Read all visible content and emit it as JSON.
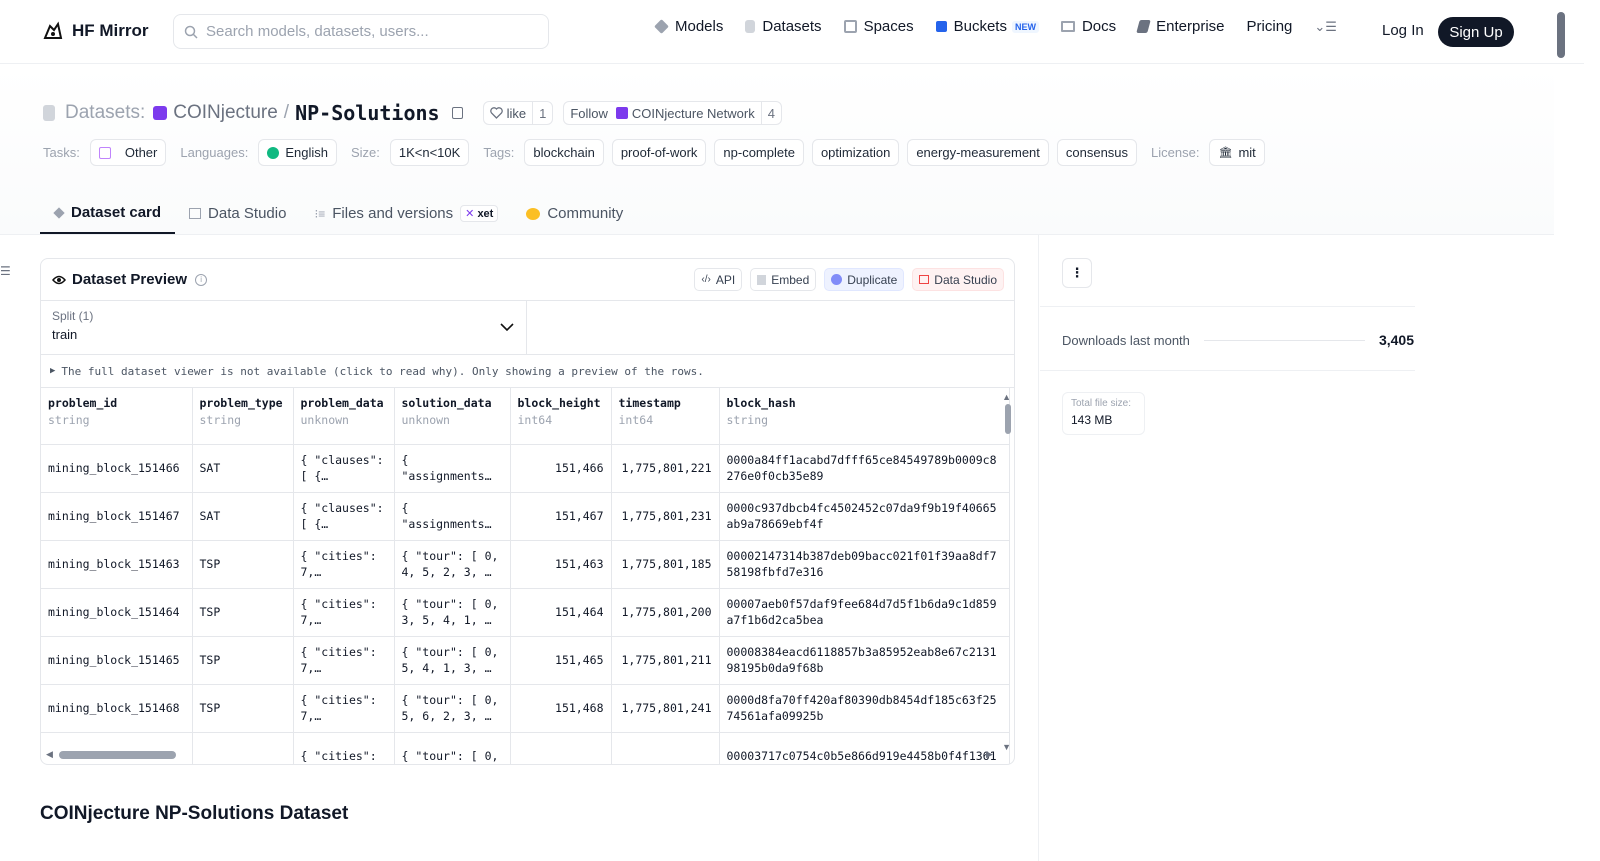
{
  "nav": {
    "brand": "HF Mirror",
    "search_placeholder": "Search models, datasets, users...",
    "links": {
      "models": "Models",
      "datasets": "Datasets",
      "spaces": "Spaces",
      "buckets": "Buckets",
      "buckets_badge": "NEW",
      "docs": "Docs",
      "enterprise": "Enterprise",
      "pricing": "Pricing"
    },
    "login": "Log In",
    "signup": "Sign Up"
  },
  "header": {
    "section_label": "Datasets:",
    "org": "COINjecture",
    "separator": "/",
    "name": "NP-Solutions",
    "like_label": "like",
    "like_count": "1",
    "follow_label": "Follow",
    "follow_org": "COINjecture Network",
    "follow_count": "4"
  },
  "tags": {
    "tasks_label": "Tasks:",
    "task": "Other",
    "languages_label": "Languages:",
    "language": "English",
    "size_label": "Size:",
    "size": "1K<n<10K",
    "tags_label": "Tags:",
    "tag_list": [
      "blockchain",
      "proof-of-work",
      "np-complete",
      "optimization",
      "energy-measurement",
      "consensus"
    ],
    "license_label": "License:",
    "license": "mit"
  },
  "tabs": {
    "dataset_card": "Dataset card",
    "data_studio": "Data Studio",
    "files": "Files and versions",
    "xet": "xet",
    "community": "Community"
  },
  "preview": {
    "title": "Dataset Preview",
    "buttons": {
      "api": "API",
      "embed": "Embed",
      "duplicate": "Duplicate",
      "data_studio": "Data Studio"
    },
    "split_label": "Split (1)",
    "split_value": "train",
    "notice": "The full dataset viewer is not available (click to read why). Only showing a preview of the rows.",
    "columns": [
      {
        "name": "problem_id",
        "type": "string"
      },
      {
        "name": "problem_type",
        "type": "string"
      },
      {
        "name": "problem_data",
        "type": "unknown"
      },
      {
        "name": "solution_data",
        "type": "unknown"
      },
      {
        "name": "block_height",
        "type": "int64"
      },
      {
        "name": "timestamp",
        "type": "int64"
      },
      {
        "name": "block_hash",
        "type": "string"
      }
    ],
    "rows": [
      [
        "mining_block_151466",
        "SAT",
        "{ \"clauses\":\n[ {…",
        "{\n\"assignments…",
        "151,466",
        "1,775,801,221",
        "0000a84ff1acabd7dfff65ce84549789b0009c8\n276e0f0cb35e89"
      ],
      [
        "mining_block_151467",
        "SAT",
        "{ \"clauses\":\n[ {…",
        "{\n\"assignments…",
        "151,467",
        "1,775,801,231",
        "0000c937dbcb4fc4502452c07da9f9b19f40665\nab9a78669ebf4f"
      ],
      [
        "mining_block_151463",
        "TSP",
        "{ \"cities\":\n7,…",
        "{ \"tour\": [ 0,\n4, 5, 2, 3, …",
        "151,463",
        "1,775,801,185",
        "00002147314b387deb09bacc021f01f39aa8df7\n58198fbfd7e316"
      ],
      [
        "mining_block_151464",
        "TSP",
        "{ \"cities\":\n7,…",
        "{ \"tour\": [ 0,\n3, 5, 4, 1, …",
        "151,464",
        "1,775,801,200",
        "00007aeb0f57daf9fee684d7d5f1b6da9c1d859\na7f1b6d2ca5bea"
      ],
      [
        "mining_block_151465",
        "TSP",
        "{ \"cities\":\n7,…",
        "{ \"tour\": [ 0,\n5, 4, 1, 3, …",
        "151,465",
        "1,775,801,211",
        "00008384eacd6118857b3a85952eab8e67c2131\n98195b0da9f68b"
      ],
      [
        "mining_block_151468",
        "TSP",
        "{ \"cities\":\n7,…",
        "{ \"tour\": [ 0,\n5, 6, 2, 3, …",
        "151,468",
        "1,775,801,241",
        "0000d8fa70ff420af80390db8454df185c63f25\n74561afa09925b"
      ],
      [
        "",
        "",
        "{ \"cities\":",
        "{ \"tour\": [ 0,",
        "",
        "",
        "00003717c0754c0b5e866d919e4458b0f4f1361"
      ]
    ]
  },
  "card_heading": "COINjecture NP-Solutions Dataset",
  "sidebar": {
    "downloads_label": "Downloads last month",
    "downloads_value": "3,405",
    "filesize_label": "Total file size:",
    "filesize_value": "143 MB"
  },
  "colors": {
    "accent": "#111827",
    "brand_purple": "#7c3aed",
    "border": "#e5e7eb"
  }
}
